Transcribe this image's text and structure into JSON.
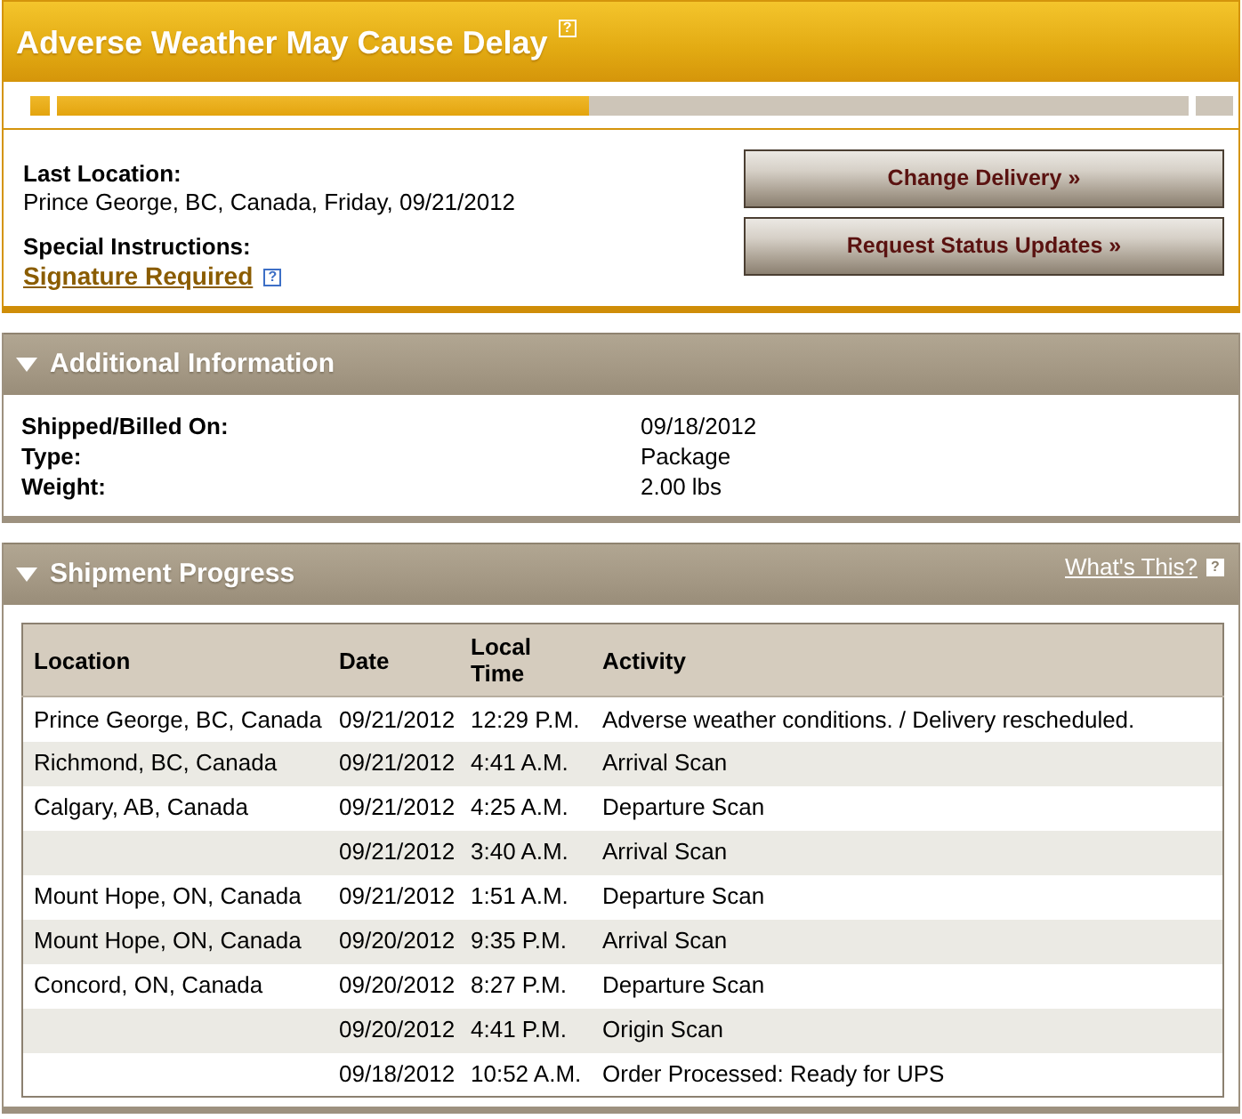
{
  "alert": {
    "title": "Adverse Weather May Cause Delay",
    "help_icon": "?"
  },
  "progress_bar": {
    "segments": [
      {
        "level": 1
      },
      {
        "level": 0.47
      },
      {
        "level": 0
      }
    ]
  },
  "summary": {
    "last_location_label": "Last Location:",
    "last_location": "Prince George, BC, Canada, Friday, 09/21/2012",
    "special_instructions_label": "Special Instructions:",
    "special_instruction": "Signature Required",
    "special_instruction_help_icon": "?"
  },
  "actions": [
    "Change Delivery »",
    "Request Status Updates »"
  ],
  "additional_information": {
    "title": "Additional Information",
    "expanded": true,
    "rows": [
      {
        "label": "Shipped/Billed On:",
        "value": "09/18/2012"
      },
      {
        "label": "Type:",
        "value": "Package"
      },
      {
        "label": "Weight:",
        "value": "2.00 lbs"
      }
    ]
  },
  "shipment_progress": {
    "title": "Shipment Progress",
    "expanded": true,
    "help_link": "What's This?",
    "help_icon": "?",
    "columns": [
      "Location",
      "Date",
      "Local Time",
      "Activity"
    ],
    "rows": [
      {
        "location": "Prince George, BC, Canada",
        "date": "09/21/2012",
        "time": "12:29 P.M.",
        "activity": "Adverse weather conditions. / Delivery rescheduled."
      },
      {
        "location": "Richmond, BC, Canada",
        "date": "09/21/2012",
        "time": "4:41 A.M.",
        "activity": "Arrival Scan"
      },
      {
        "location": "Calgary, AB, Canada",
        "date": "09/21/2012",
        "time": "4:25 A.M.",
        "activity": "Departure Scan"
      },
      {
        "date": "09/21/2012",
        "time": "3:40 A.M.",
        "activity": "Arrival Scan"
      },
      {
        "location": "Mount Hope, ON, Canada",
        "date": "09/21/2012",
        "time": "1:51 A.M.",
        "activity": "Departure Scan"
      },
      {
        "location": "Mount Hope, ON, Canada",
        "date": "09/20/2012",
        "time": "9:35 P.M.",
        "activity": "Arrival Scan"
      },
      {
        "location": "Concord, ON, Canada",
        "date": "09/20/2012",
        "time": "8:27 P.M.",
        "activity": "Departure Scan"
      },
      {
        "date": "09/20/2012",
        "time": "4:41 P.M.",
        "activity": "Origin Scan"
      },
      {
        "date": "09/18/2012",
        "time": "10:52 A.M.",
        "activity": "Order Processed: Ready for UPS"
      }
    ]
  }
}
